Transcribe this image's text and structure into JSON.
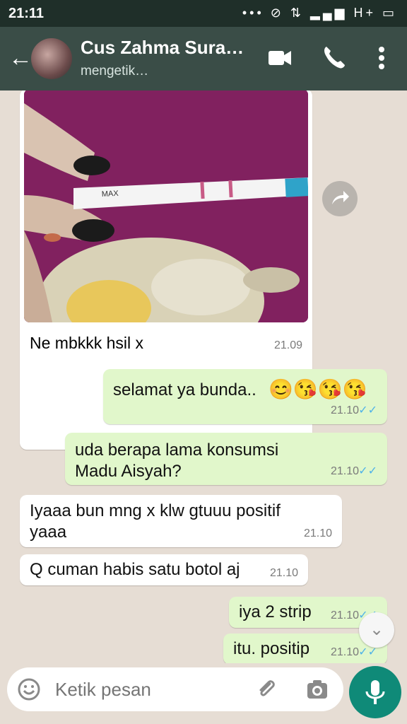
{
  "status_bar": {
    "time": "21:11",
    "signal": "H+"
  },
  "header": {
    "contact_name": "Cus Zahma Sura…",
    "status": "mengetik…",
    "icons": [
      "back-arrow-icon",
      "video-call-icon",
      "phone-icon",
      "more-icon"
    ]
  },
  "messages": [
    {
      "type": "image",
      "direction": "in",
      "caption": "Ne mbkkk hsil x",
      "time": "21.09"
    },
    {
      "type": "text",
      "direction": "out",
      "text": "selamat ya bunda..",
      "emoji": "😊😘😘😘",
      "time": "21.10"
    },
    {
      "type": "text",
      "direction": "out",
      "text": "uda berapa lama konsumsi Madu Aisyah?",
      "time": "21.10"
    },
    {
      "type": "text",
      "direction": "in",
      "text": "Iyaaa bun mng x klw gtuuu positif yaaa",
      "time": "21.10"
    },
    {
      "type": "text",
      "direction": "in",
      "text": "Q cuman habis satu botol aj",
      "time": "21.10"
    },
    {
      "type": "text",
      "direction": "out",
      "text": "iya 2 strip",
      "time": "21.10"
    },
    {
      "type": "text",
      "direction": "out",
      "text": "itu. positip",
      "time": "21.10"
    }
  ],
  "input": {
    "placeholder": "Ketik pesan"
  },
  "colors": {
    "header": "#3a4d47",
    "outgoing": "#e1f7cb",
    "accent": "#0f8a78",
    "read_ticks": "#4fb3e8"
  }
}
